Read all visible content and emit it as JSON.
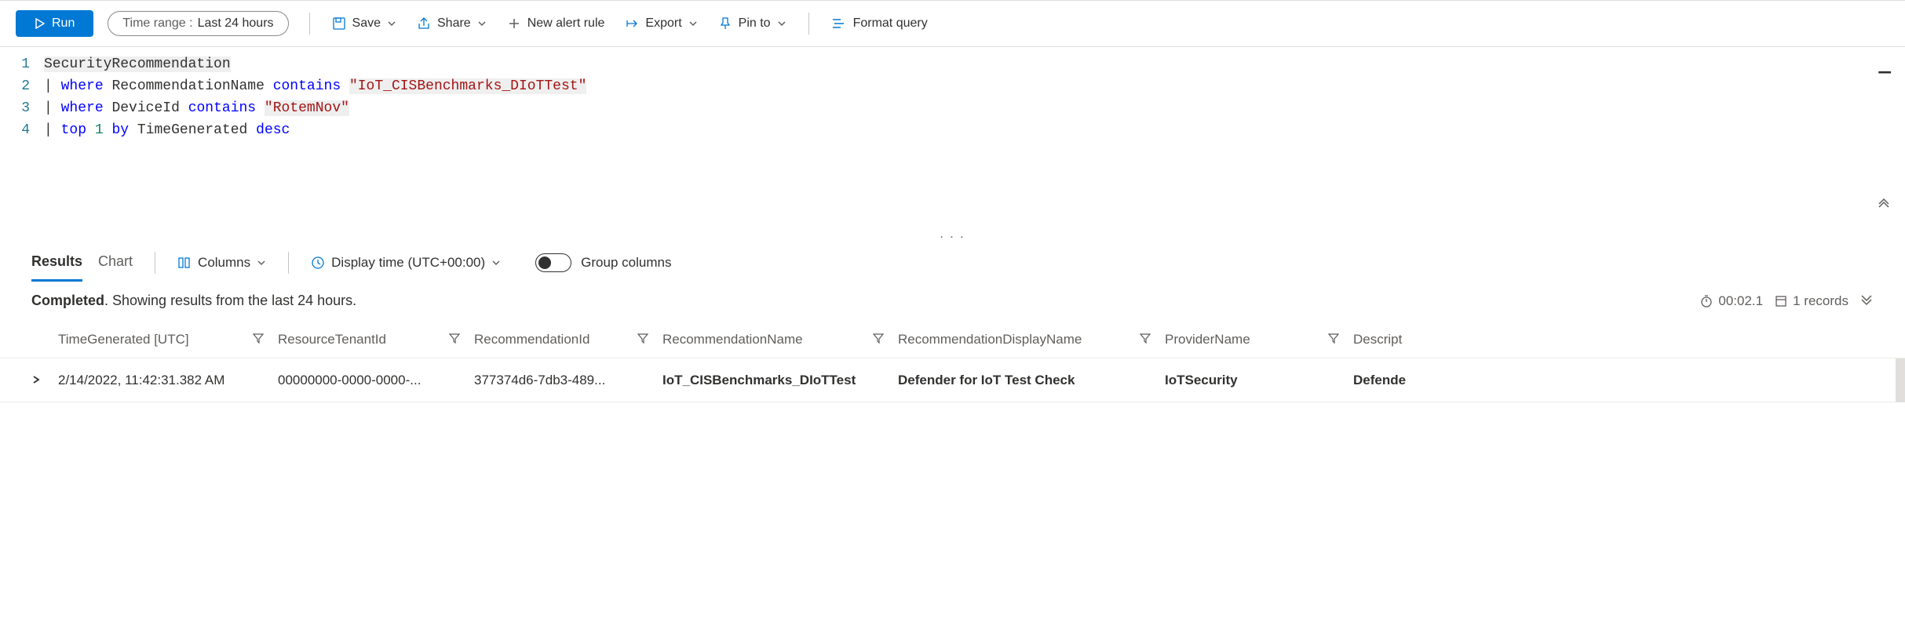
{
  "toolbar": {
    "run_label": "Run",
    "time_range_label": "Time range :",
    "time_range_value": "Last 24 hours",
    "save_label": "Save",
    "share_label": "Share",
    "new_alert_label": "New alert rule",
    "export_label": "Export",
    "pin_label": "Pin to",
    "format_label": "Format query"
  },
  "editor": {
    "lines": [
      {
        "n": "1"
      },
      {
        "n": "2"
      },
      {
        "n": "3"
      },
      {
        "n": "4"
      }
    ],
    "code": {
      "l1_table": "SecurityRecommendation",
      "l2_pipe": "|",
      "l2_where": "where",
      "l2_ident": "RecommendationName",
      "l2_op": "contains",
      "l2_str": "\"IoT_CISBenchmarks_DIoTTest\"",
      "l3_pipe": "|",
      "l3_where": "where",
      "l3_ident": "DeviceId",
      "l3_op": "contains",
      "l3_str": "\"RotemNov\"",
      "l4_pipe": "|",
      "l4_top": "top",
      "l4_num": "1",
      "l4_by": "by",
      "l4_ident": "TimeGenerated",
      "l4_desc": "desc"
    }
  },
  "splitter_dots": ". . .",
  "results_tabs": {
    "results": "Results",
    "chart": "Chart",
    "columns": "Columns",
    "display_time": "Display time (UTC+00:00)",
    "group_columns": "Group columns"
  },
  "status": {
    "completed": "Completed",
    "message": ". Showing results from the last 24 hours.",
    "duration": "00:02.1",
    "records": "1 records"
  },
  "grid": {
    "headers": {
      "h1": "TimeGenerated [UTC]",
      "h2": "ResourceTenantId",
      "h3": "RecommendationId",
      "h4": "RecommendationName",
      "h5": "RecommendationDisplayName",
      "h6": "ProviderName",
      "h7": "Descript"
    },
    "rows": [
      {
        "c1": "2/14/2022, 11:42:31.382 AM",
        "c2": "00000000-0000-0000-...",
        "c3": "377374d6-7db3-489...",
        "c4": "IoT_CISBenchmarks_DIoTTest",
        "c5": "Defender for IoT Test Check",
        "c6": "IoTSecurity",
        "c7": "Defende"
      }
    ]
  }
}
